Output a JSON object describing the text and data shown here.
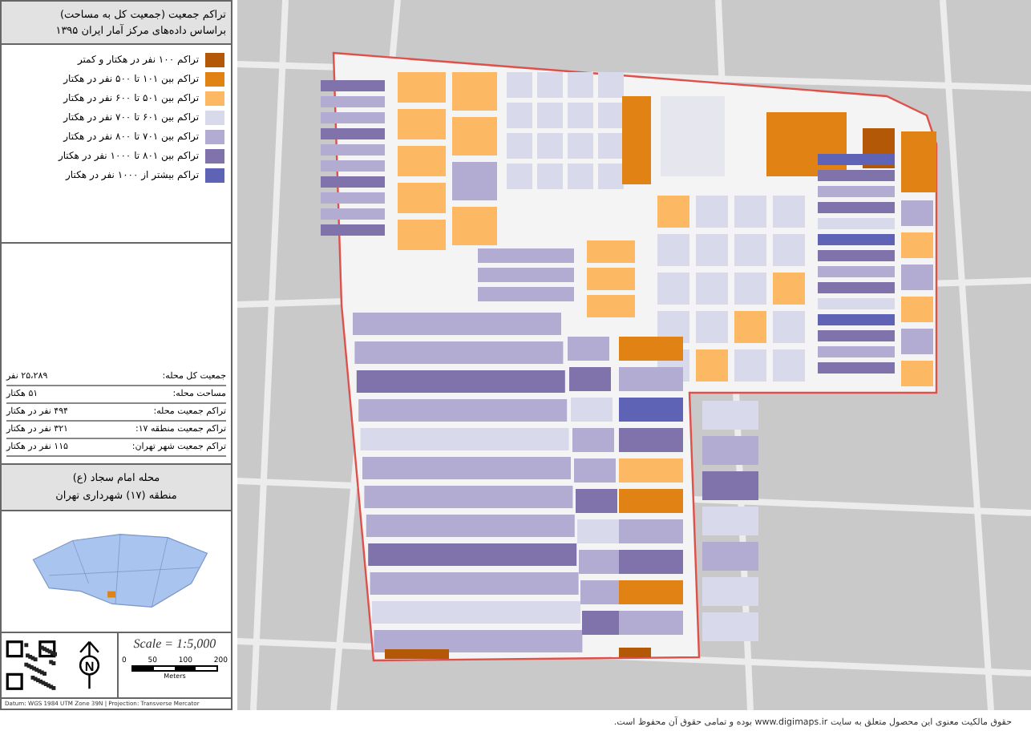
{
  "legend": {
    "title": "تراکم جمعیت (جمعیت کل به مساحت)",
    "subtitle": "براساس داده‌های مرکز آمار ایران ۱۳۹۵",
    "items": [
      {
        "label": "تراکم ۱۰۰ نفر در هکتار و کمتر",
        "color": "#b35806"
      },
      {
        "label": "تراکم بین ۱۰۱ تا ۵۰۰ نفر در هکتار",
        "color": "#e08214"
      },
      {
        "label": "تراکم بین ۵۰۱ تا ۶۰۰ نفر در هکتار",
        "color": "#fdb863"
      },
      {
        "label": "تراکم بین ۶۰۱ تا ۷۰۰ نفر در هکتار",
        "color": "#d8daeb"
      },
      {
        "label": "تراکم بین ۷۰۱ تا ۸۰۰ نفر در هکتار",
        "color": "#b2abd2"
      },
      {
        "label": "تراکم بین ۸۰۱ تا ۱۰۰۰ نفر در هکتار",
        "color": "#8073ac"
      },
      {
        "label": "تراکم بیشتر از ۱۰۰۰ نفر در هکتار",
        "color": "#5e63b6"
      }
    ]
  },
  "stats": [
    {
      "label": "جمعیت کل محله:",
      "value": "۲۵،۲۸۹ نفر"
    },
    {
      "label": "مساحت محله:",
      "value": "۵۱ هکتار"
    },
    {
      "label": "تراکم جمعیت محله:",
      "value": "۴۹۴ نفر در هکتار"
    },
    {
      "label": "تراکم جمعیت منطقه ۱۷:",
      "value": "۳۲۱ نفر در هکتار"
    },
    {
      "label": "تراکم جمعیت شهر تهران:",
      "value": "۱۱۵ نفر در هکتار"
    }
  ],
  "place": {
    "name": "محله امام سجاد (ع)",
    "district": "منطقه (۱۷) شهرداری تهران"
  },
  "north": "N",
  "scale": {
    "text": "Scale = 1:5,000",
    "ticks": [
      "200",
      "100",
      "50",
      "0"
    ],
    "unit": "Meters"
  },
  "credit": "Datum: WGS 1984 UTM Zone 39N | Projection: Transverse Mercator",
  "footer": "حقوق مالکیت معنوی این محصول متعلق به سایت www.digimaps.ir بوده و تمامی حقوق آن محفوظ است."
}
